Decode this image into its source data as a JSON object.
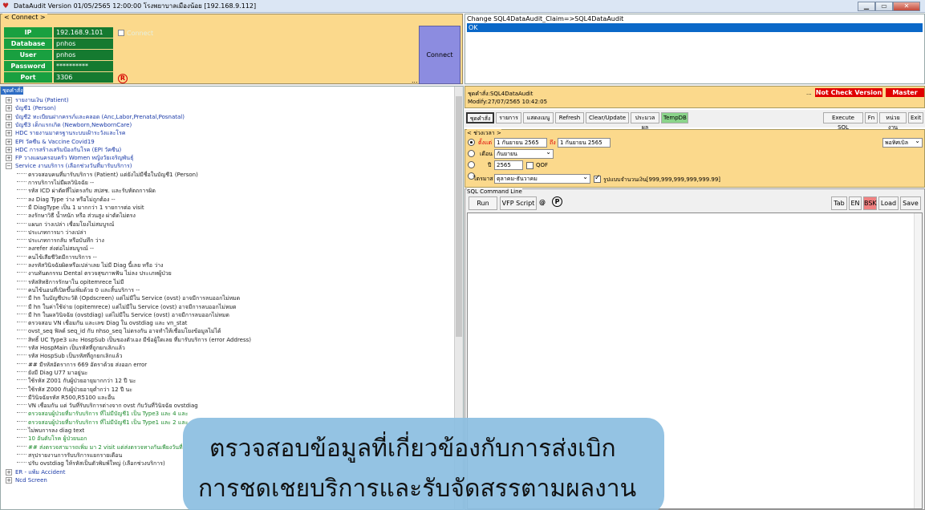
{
  "window": {
    "title": "DataAudit Version 01/05/2565 12:00:00 โรงพยาบาลเมืองน้อย [192.168.9.112]"
  },
  "connect": {
    "group_title": "< Connect >",
    "fields": [
      {
        "label": "IP",
        "value": "192.168.9.101"
      },
      {
        "label": "Database",
        "value": "pnhos"
      },
      {
        "label": "User",
        "value": "pnhos"
      },
      {
        "label": "Password",
        "value": "**********"
      },
      {
        "label": "Port",
        "value": "3306"
      }
    ],
    "connect_checkbox_label": "Connect",
    "connect_button": "Connect",
    "r_mark": "R",
    "ellipsis": "..."
  },
  "change_panel": {
    "line": "Change SQL4DataAudit_Claim=>SQL4DataAudit",
    "status": "OK"
  },
  "tree": {
    "header": "ชุดคำสั่ง",
    "items": [
      {
        "text": "รายงานเงิน (Patient)",
        "type": "node",
        "color": "blue"
      },
      {
        "text": "บัญชี1 (Person)",
        "type": "node",
        "color": "blue"
      },
      {
        "text": "บัญชี2 ทะเบียนฝากครรภ์และคลอด (Anc,Labor,Prenatal,Posnatal)",
        "type": "node",
        "color": "blue"
      },
      {
        "text": "บัญชี3 เด็กแรกเกิด (Newborn,NewbornCare)",
        "type": "node",
        "color": "blue"
      },
      {
        "text": "HDC รายงานมาตรฐานระบบเฝ้าระวังและโรค",
        "type": "node",
        "color": "blue"
      },
      {
        "text": "EPI วัคซีน & Vaccine Covid19",
        "type": "node",
        "color": "blue"
      },
      {
        "text": "HDC การสร้างเสริมป้องกันโรค (EPI วัคซีน)",
        "type": "node",
        "color": "blue"
      },
      {
        "text": "FP วางแผนครอบครัว Women หญิงวัยเจริญพันธุ์",
        "type": "node",
        "color": "blue"
      },
      {
        "text": "Service งานบริการ (เลือกช่วงวันที่มารับบริการ)",
        "type": "open",
        "color": "blue"
      },
      {
        "text": "ตรวจสอบคนที่มารับบริการ (Patient) แต่ยังไม่มีชื่อในบัญชี1 (Person)",
        "type": "leaf",
        "color": "dark"
      },
      {
        "text": "การบริการไม่มีผลวินิจฉัย --",
        "type": "leaf",
        "color": "dark"
      },
      {
        "text": "รหัส ICD ผ่าตัดที่ไม่ตรงกับ สปสช. และรับหัตถการผิด",
        "type": "leaf",
        "color": "dark"
      },
      {
        "text": "ลง Diag Type ว่าง หรือไม่ถูกต้อง --",
        "type": "leaf",
        "color": "dark"
      },
      {
        "text": "มี DiagType เป็น 1 มากกว่า 1 รายการต่อ visit",
        "type": "leaf",
        "color": "dark"
      },
      {
        "text": "ลงรักษาวิธี น้ำหนัก หรือ ส่วนสูง ผ่าตัดไม่ตรง",
        "type": "leaf",
        "color": "dark"
      },
      {
        "text": "แผนก ว่างเปล่า เชื่อมโยงไม่สมบูรณ์",
        "type": "leaf",
        "color": "dark"
      },
      {
        "text": "ประเภทการมา ว่างเปล่า",
        "type": "leaf",
        "color": "dark"
      },
      {
        "text": "ประเภทการกลับ หรือบันทึก ว่าง",
        "type": "leaf",
        "color": "dark"
      },
      {
        "text": "ลงrefer ส่งต่อไม่สมบูรณ์ --",
        "type": "leaf",
        "color": "dark"
      },
      {
        "text": "คนไข้เสียชีวิตมีการบริการ --",
        "type": "leaf",
        "color": "dark"
      },
      {
        "text": "ลงรหัสวินิจฉัยผิดหรือเปล่าเลย ไม่มี Diag นี้เลย หรือ ว่าง",
        "type": "leaf",
        "color": "dark"
      },
      {
        "text": "งานทันตกรรม Dental ตรวจสุขภาพฟัน ไม่ลง ประเภทผู้ป่วย",
        "type": "leaf",
        "color": "dark"
      },
      {
        "text": "รหัสสิทธิการรักษาใน opitemrece ไม่มี",
        "type": "leaf",
        "color": "dark"
      },
      {
        "text": "คนไข้นอนที่เปิดขึ้นเพิ่มด้วย 0 และสิ้นบริการ --",
        "type": "leaf",
        "color": "dark"
      },
      {
        "text": "มี hn ในบัญชีประวัติ (Opdscreen) แต่ไม่มีใน Service (ovst) อาจมีการลบออกไม่หมด",
        "type": "leaf",
        "color": "dark"
      },
      {
        "text": "มี hn ในค่าใช้จ่าย (opitemrece) แต่ไม่มีใน Service (ovst) อาจมีการลบออกไม่หมด",
        "type": "leaf",
        "color": "dark"
      },
      {
        "text": "มี hn ในผลวินิจฉัย (ovstdiag) แต่ไม่มีใน Service (ovst) อาจมีการลบออกไม่หมด",
        "type": "leaf",
        "color": "dark"
      },
      {
        "text": "ตรวจสอบ VN เชื่อมกัน และเลข Diag ใน ovstdiag และ vn_stat",
        "type": "leaf",
        "color": "dark"
      },
      {
        "text": "ovst_seq ฟิลด์ seq_id กับ nhso_seq ไม่ตรงกัน อาจทำให้เชื่อมโยงข้อมูลไม่ได้",
        "type": "leaf",
        "color": "dark"
      },
      {
        "text": "สิทธิ์ UC Type3 และ HospSub เป็นของตัวเอง มีข้อผู้ใดเลย ที่มารับบริการ (error Address)",
        "type": "leaf",
        "color": "dark"
      },
      {
        "text": "รหัส HospMain เป็นรหัสที่ถูกยกเลิกแล้ว",
        "type": "leaf",
        "color": "dark"
      },
      {
        "text": "รหัส HospSub เป็นรหัสที่ถูกยกเลิกแล้ว",
        "type": "leaf",
        "color": "dark"
      },
      {
        "text": "## มีรหัสอัตราการ 669 อัตราด้วย ส่งออก error",
        "type": "leaf",
        "color": "dark"
      },
      {
        "text": "ยังมี Diag U77 มาอยู่นะ",
        "type": "leaf",
        "color": "dark"
      },
      {
        "text": "ใช้รหัส Z001 กับผู้ป่วยอายุมากกว่า 12 ปี นะ",
        "type": "leaf",
        "color": "dark"
      },
      {
        "text": "ใช้รหัส Z000 กับผู้ป่วยอายุต่ำกว่า 12 ปี นะ",
        "type": "leaf",
        "color": "dark"
      },
      {
        "text": "มีวินิจฉัยรหัส R500,R5100 และอื่น",
        "type": "leaf",
        "color": "dark"
      },
      {
        "text": "VN เชื่อมกัน แต่ วันที่รับบริการต่างจาก ovst กับวันที่วินิจฉัย ovstdiag",
        "type": "leaf",
        "color": "dark"
      },
      {
        "text": "ตรวจสอบผู้ป่วยที่มารับบริการ ที่ไม่มีบัญชี1 เป็น Type3 และ 4 และ",
        "type": "leaf",
        "color": "green"
      },
      {
        "text": "ตรวจสอบผู้ป่วยที่มารับบริการ ที่ไม่มีบัญชี1 เป็น Type1 และ 2 และ",
        "type": "leaf",
        "color": "green"
      },
      {
        "text": "ไม่พบการลง diag text",
        "type": "leaf",
        "color": "dark"
      },
      {
        "text": "10 อันดับโรค ผู้ป่วยนอก",
        "type": "leaf",
        "color": "green"
      },
      {
        "text": "## ส่งตรวจสามารถเพิ่ม มา 2 visit แต่ส่งตรวจทางกันเพียงวันที่",
        "type": "leaf",
        "color": "green"
      },
      {
        "text": "สรุปรายงานการรับบริการแยกรายเดือน",
        "type": "leaf",
        "color": "dark"
      },
      {
        "text": "ปรับ ovstdiag ให้รหัสเป็นตัวพิมพ์ใหญ่ (เลือกช่วงบริการ)",
        "type": "leaf",
        "color": "dark"
      },
      {
        "text": "ER - แพ้ม Accident",
        "type": "node",
        "color": "blue"
      },
      {
        "text": "Ncd Screen",
        "type": "node",
        "color": "blue"
      }
    ]
  },
  "info": {
    "line1": "ชุดคำสั่ง:SQL4DataAudit",
    "line2": "Modify:27/07/2565 10:42:05",
    "ellipsis": "...",
    "not_check_version": "Not Check Version",
    "master": "Master"
  },
  "toolbar": {
    "buttons": [
      "ชุดคำสั่ง",
      "รายการ",
      "แสดงเมนู",
      "Refresh",
      "Clear/Update",
      "ประมวลผล",
      "TempDB"
    ],
    "right_buttons": [
      "Execute SQL",
      "Fn",
      "หน่วยงาน",
      "Exit"
    ]
  },
  "period": {
    "group_title": "< ช่วงเวลา >",
    "start_label": "ตั้งแต่",
    "start_date": "1 กันยายน 2565",
    "to_label": "ถึง",
    "end_date": "1 กันยายน 2565",
    "month_label": "เดือน",
    "month_value": "กันยายน",
    "year_label": "ปี",
    "year_value": "2565",
    "qof_label": "QOF",
    "quarter_label": "ไตรมาส",
    "quarter_value": "ตุลาคม-ธันวาคม",
    "format_label": "รูปแบบจำนวนเงิน[999,999,999,999,999.99]",
    "right_dropdown": "พอทิศเบิล"
  },
  "sql": {
    "group_title": "SQL Command Line",
    "run": "Run",
    "vfp": "VFP Script",
    "at": "@",
    "p": "P",
    "tab": "Tab",
    "en": "EN",
    "bsk": "BSK",
    "load": "Load",
    "save": "Save"
  },
  "overlay": {
    "line1": "ตรวจสอบข้อมูลที่เกี่ยวข้องกับการส่งเบิก",
    "line2": "การชดเชยบริการและรับจัดสรรตามผลงาน"
  }
}
